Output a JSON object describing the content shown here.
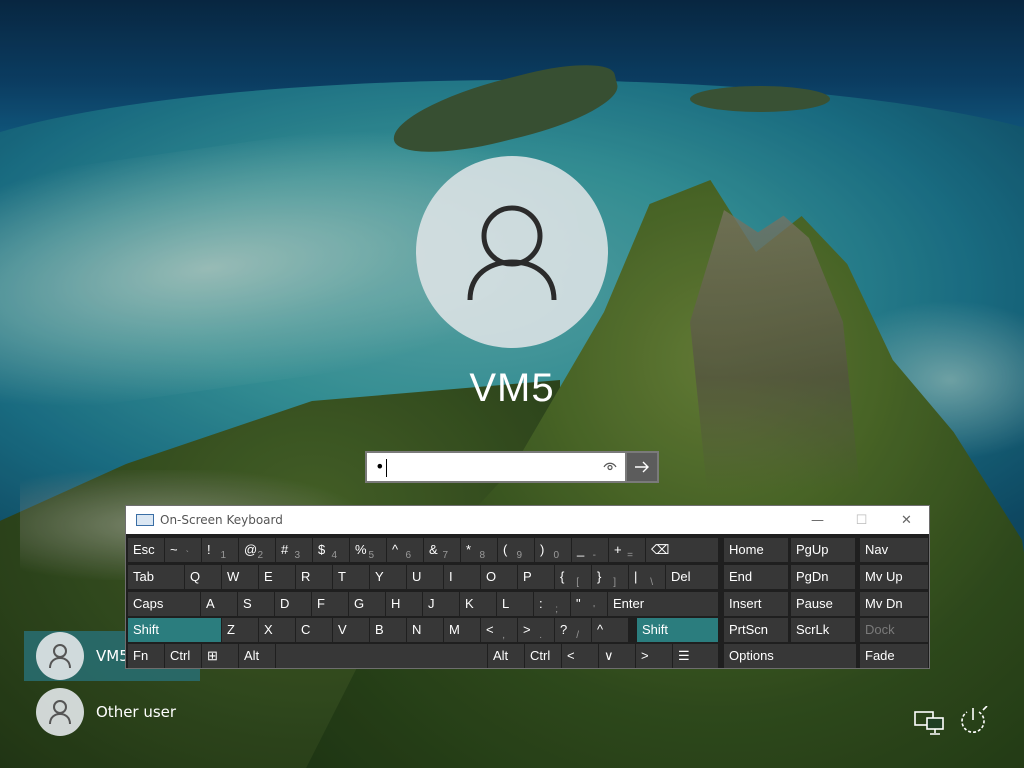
{
  "login": {
    "username": "VM5",
    "password_mask": "•",
    "reveal_icon": "eye-icon",
    "submit_icon": "arrow-right-icon"
  },
  "users": [
    {
      "name": "VM5",
      "selected": true
    },
    {
      "name": "Other user",
      "selected": false
    }
  ],
  "corner_icons": [
    "network-icon",
    "power-accessibility-icon"
  ],
  "osk": {
    "title": "On-Screen Keyboard",
    "controls": {
      "minimize": "—",
      "maximize": "☐",
      "close": "✕"
    },
    "rows": [
      [
        {
          "main": "Esc"
        },
        {
          "main": "~",
          "sub": "`"
        },
        {
          "main": "!",
          "sub": "1"
        },
        {
          "main": "@",
          "sub": "2"
        },
        {
          "main": "#",
          "sub": "3"
        },
        {
          "main": "$",
          "sub": "4"
        },
        {
          "main": "%",
          "sub": "5"
        },
        {
          "main": "^",
          "sub": "6"
        },
        {
          "main": "&",
          "sub": "7"
        },
        {
          "main": "*",
          "sub": "8"
        },
        {
          "main": "(",
          "sub": "9"
        },
        {
          "main": ")",
          "sub": "0"
        },
        {
          "main": "_",
          "sub": "-"
        },
        {
          "main": "+",
          "sub": "="
        },
        {
          "main": "⌫"
        },
        {
          "main": "Home"
        },
        {
          "main": "PgUp"
        },
        {
          "main": "Nav"
        }
      ],
      [
        {
          "main": "Tab"
        },
        {
          "main": "Q"
        },
        {
          "main": "W"
        },
        {
          "main": "E"
        },
        {
          "main": "R"
        },
        {
          "main": "T"
        },
        {
          "main": "Y"
        },
        {
          "main": "U"
        },
        {
          "main": "I"
        },
        {
          "main": "O"
        },
        {
          "main": "P"
        },
        {
          "main": "{",
          "sub": "["
        },
        {
          "main": "}",
          "sub": "]"
        },
        {
          "main": "|",
          "sub": "\\"
        },
        {
          "main": "Del"
        },
        {
          "main": "End"
        },
        {
          "main": "PgDn"
        },
        {
          "main": "Mv Up"
        }
      ],
      [
        {
          "main": "Caps"
        },
        {
          "main": "A"
        },
        {
          "main": "S"
        },
        {
          "main": "D"
        },
        {
          "main": "F"
        },
        {
          "main": "G"
        },
        {
          "main": "H"
        },
        {
          "main": "J"
        },
        {
          "main": "K"
        },
        {
          "main": "L"
        },
        {
          "main": ":",
          "sub": ";"
        },
        {
          "main": "\"",
          "sub": "'"
        },
        {
          "main": "Enter"
        },
        {
          "main": "Insert"
        },
        {
          "main": "Pause"
        },
        {
          "main": "Mv Dn"
        }
      ],
      [
        {
          "main": "Shift",
          "accent": true
        },
        {
          "main": "Z"
        },
        {
          "main": "X"
        },
        {
          "main": "C"
        },
        {
          "main": "V"
        },
        {
          "main": "B"
        },
        {
          "main": "N"
        },
        {
          "main": "M"
        },
        {
          "main": "<",
          "sub": ","
        },
        {
          "main": ">",
          "sub": "."
        },
        {
          "main": "?",
          "sub": "/"
        },
        {
          "main": "^"
        },
        {
          "main": "Shift",
          "accent": true
        },
        {
          "main": "PrtScn"
        },
        {
          "main": "ScrLk"
        },
        {
          "main": "Dock",
          "disabled": true
        }
      ],
      [
        {
          "main": "Fn"
        },
        {
          "main": "Ctrl"
        },
        {
          "main": "⊞"
        },
        {
          "main": "Alt"
        },
        {
          "main": ""
        },
        {
          "main": "Alt"
        },
        {
          "main": "Ctrl"
        },
        {
          "main": "<"
        },
        {
          "main": "∨"
        },
        {
          "main": ">"
        },
        {
          "main": "☰"
        },
        {
          "main": "Options"
        },
        {
          "main": "Fade"
        }
      ]
    ]
  }
}
